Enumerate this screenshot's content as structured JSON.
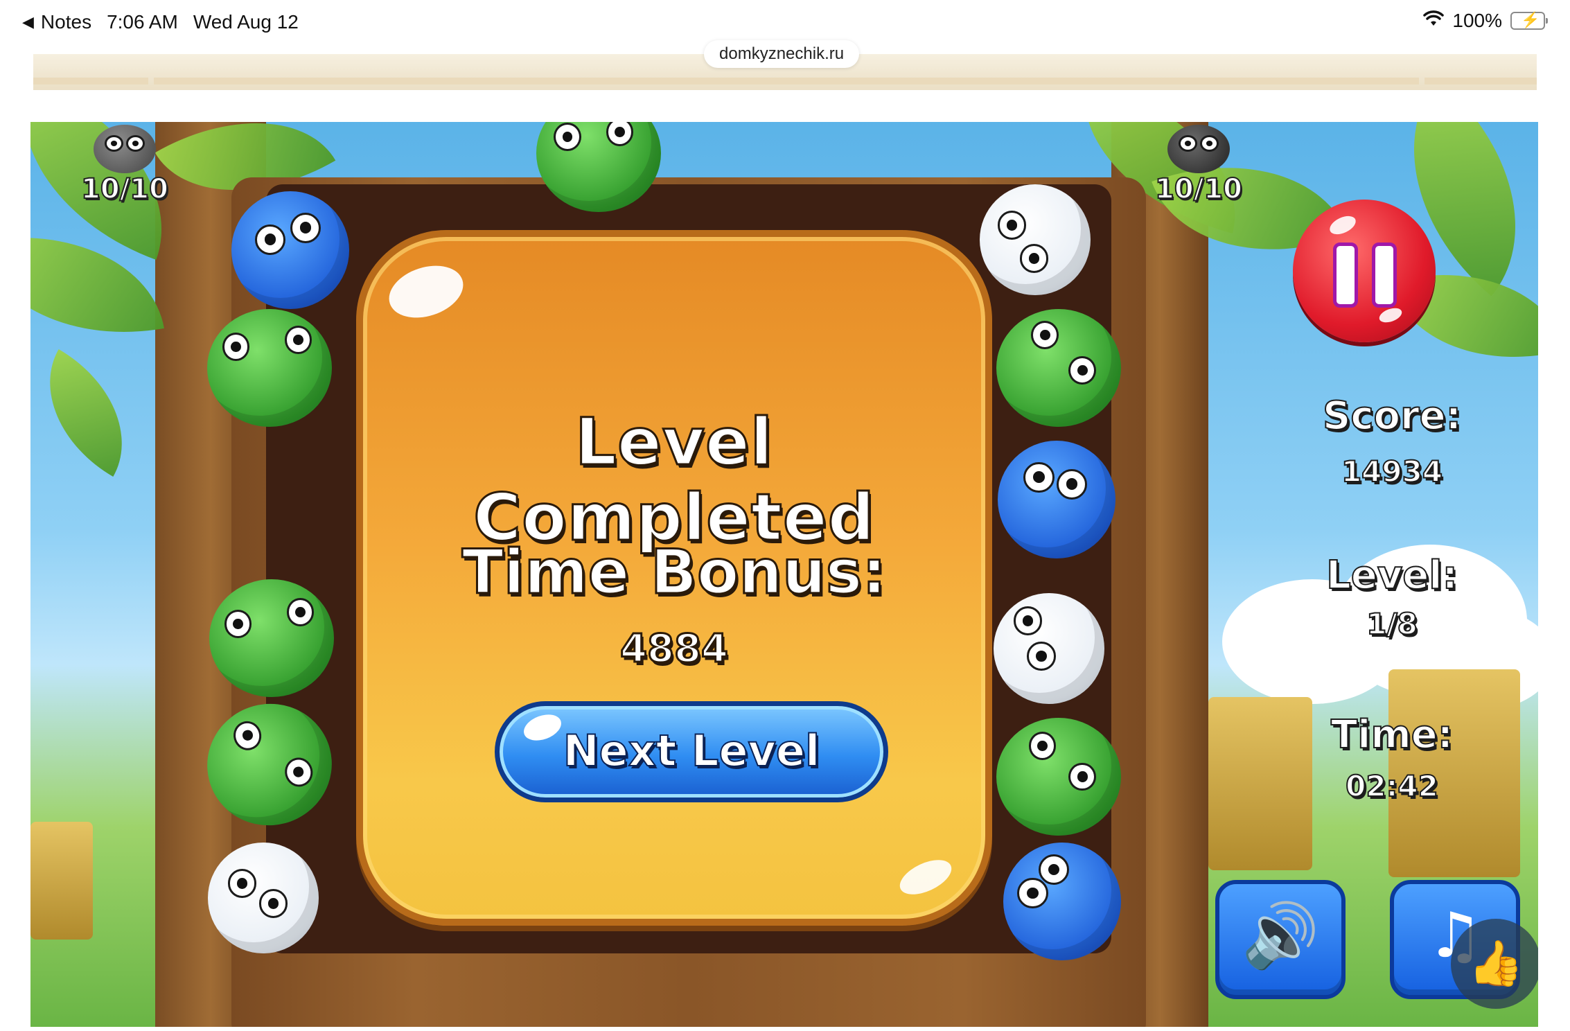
{
  "statusbar": {
    "back_label": "Notes",
    "time": "7:06 AM",
    "date": "Wed Aug 12",
    "battery": "100%"
  },
  "browser": {
    "url": "domkyznechik.ru"
  },
  "game": {
    "counter_left": "10/10",
    "counter_right": "10/10",
    "score_label": "Score:",
    "score_value": "14934",
    "level_label": "Level:",
    "level_value": "1/8",
    "time_label": "Time:",
    "time_value": "02:42",
    "icons": {
      "pause": "pause-icon",
      "sound": "speaker-icon",
      "music": "music-note-icon",
      "like": "thumbs-up-icon"
    }
  },
  "dialog": {
    "title": "Level Completed",
    "bonus_label": "Time Bonus:",
    "bonus_value": "4884",
    "next_button": "Next Level"
  }
}
